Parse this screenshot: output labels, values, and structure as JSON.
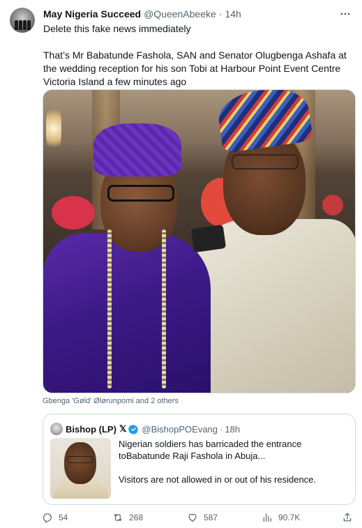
{
  "tweet": {
    "author": {
      "display_name": "May Nigeria Succeed",
      "handle": "@QueenAbeeke",
      "avatar": "avatar-icon"
    },
    "separator": "·",
    "time": "14h",
    "more_icon": "more-icon",
    "text": {
      "paragraph_1": "Delete this fake news immediately",
      "paragraph_2": "That’s Mr Babatunde Fashola, SAN and Senator Olugbenga Ashafa at the wedding reception for his son Tobi at Harbour Point Event Centre Victoria Island a few minutes ago"
    },
    "media_tag_line": "Gbenga 'Gøld' Ølørunpomi and 2 others"
  },
  "quoted_tweet": {
    "author": {
      "display_name": "Bishop (LP)",
      "x_badge": "𝕏",
      "handle": "@BishopPOEvang",
      "verified_icon": "verified-badge-icon"
    },
    "separator": "·",
    "time": "18h",
    "text": {
      "paragraph_1": "Nigerian soldiers has barricaded the entrance toBabatunde Raji Fashola in Abuja...",
      "paragraph_2": "Visitors are not allowed in or out of his residence."
    }
  },
  "actions": {
    "reply": {
      "icon": "reply-icon",
      "count": "54"
    },
    "retweet": {
      "icon": "retweet-icon",
      "count": "268"
    },
    "like": {
      "icon": "heart-icon",
      "count": "587"
    },
    "views": {
      "icon": "views-icon",
      "count": "90.7K"
    },
    "share": {
      "icon": "share-icon"
    }
  },
  "colors": {
    "text_primary": "#0f1419",
    "text_secondary": "#536471",
    "border": "#cfd9de",
    "verified": "#1d9bf0"
  }
}
